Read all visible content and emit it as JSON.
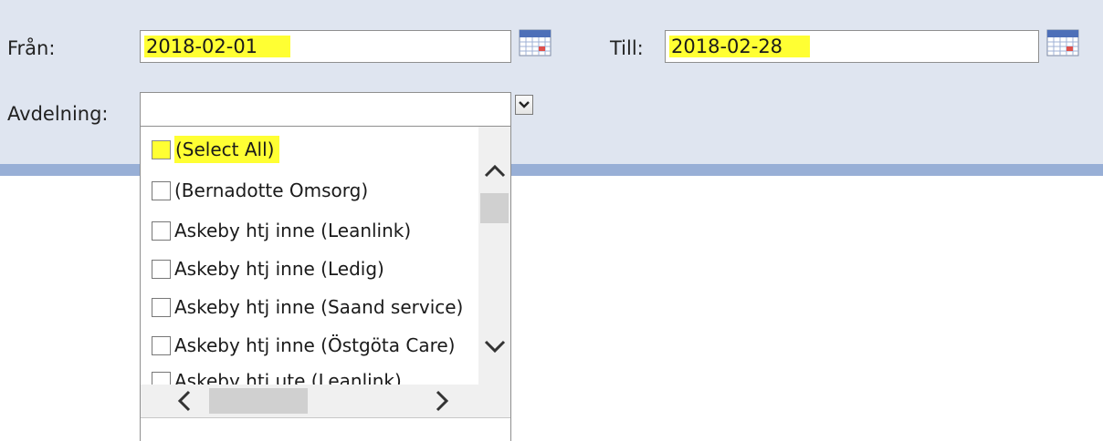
{
  "filters": {
    "from_label": "Från:",
    "from_value": "2018-02-01",
    "to_label": "Till:",
    "to_value": "2018-02-28",
    "department_label": "Avdelning:",
    "department_value": ""
  },
  "dropdown": {
    "items": [
      {
        "label": "(Select All)",
        "checked": false,
        "highlighted": true
      },
      {
        "label": "(Bernadotte Omsorg)",
        "checked": false
      },
      {
        "label": "Askeby htj inne (Leanlink)",
        "checked": false
      },
      {
        "label": "Askeby htj inne (Ledig)",
        "checked": false
      },
      {
        "label": "Askeby htj inne (Saand service)",
        "checked": false
      },
      {
        "label": "Askeby htj inne (Östgöta Care)",
        "checked": false
      },
      {
        "label": "Askeby htj ute (Leanlink)",
        "checked": false
      }
    ]
  },
  "icons": {
    "calendar": "calendar-icon",
    "combo_arrow": "chevron-down-icon",
    "scroll_up": "chevron-up-icon",
    "scroll_down": "chevron-down-icon",
    "scroll_left": "chevron-left-icon",
    "scroll_right": "chevron-right-icon"
  },
  "colors": {
    "panel_bg": "#dfe5f0",
    "panel_bar": "#98afd6",
    "highlight": "#ffff33"
  }
}
